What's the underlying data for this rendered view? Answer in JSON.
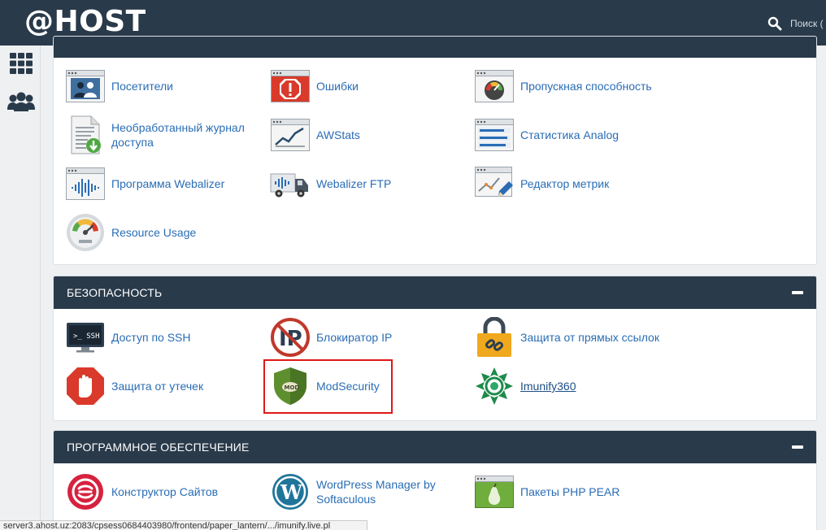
{
  "brand": {
    "logo": "@HOST"
  },
  "search": {
    "placeholder": "Поиск ("
  },
  "sidebar": {
    "items": [
      {
        "icon": "grid-icon"
      },
      {
        "icon": "users-icon"
      }
    ]
  },
  "panels": [
    {
      "header": "",
      "items": [
        {
          "label": "Посетители",
          "icon": "visitors-icon"
        },
        {
          "label": "Ошибки",
          "icon": "errors-icon"
        },
        {
          "label": "Пропускная способность",
          "icon": "bandwidth-icon"
        },
        {
          "label": "Необработанный журнал доступа",
          "icon": "raw-access-icon"
        },
        {
          "label": "AWStats",
          "icon": "awstats-icon"
        },
        {
          "label": "Статистика Analog",
          "icon": "analog-stats-icon"
        },
        {
          "label": "Программа Webalizer",
          "icon": "webalizer-icon"
        },
        {
          "label": "Webalizer FTP",
          "icon": "webalizer-ftp-icon"
        },
        {
          "label": "Редактор метрик",
          "icon": "metrics-editor-icon"
        },
        {
          "label": "Resource Usage",
          "icon": "resource-usage-icon"
        }
      ]
    },
    {
      "header": "БЕЗОПАСНОСТЬ",
      "items": [
        {
          "label": "Доступ по SSH",
          "icon": "ssh-icon"
        },
        {
          "label": "Блокиратор IP",
          "icon": "ip-blocker-icon"
        },
        {
          "label": "Защита от прямых ссылок",
          "icon": "hotlink-lock-icon"
        },
        {
          "label": "Защита от утечек",
          "icon": "leech-hand-icon"
        },
        {
          "label": "ModSecurity",
          "icon": "modsecurity-shield-icon"
        },
        {
          "label": "Imunify360",
          "icon": "imunify-icon"
        }
      ]
    },
    {
      "header": "ПРОГРАММНОЕ ОБЕСПЕЧЕНИЕ",
      "items": [
        {
          "label": "Конструктор Сайтов",
          "icon": "site-builder-icon"
        },
        {
          "label": "WordPress Manager by Softaculous",
          "icon": "wordpress-icon"
        },
        {
          "label": "Пакеты PHP PEAR",
          "icon": "php-pear-icon"
        }
      ]
    }
  ],
  "status": {
    "url": "server3.ahost.uz:2083/cpsess0684403980/frontend/paper_lantern/.../imunify.live.pl"
  },
  "colors": {
    "header": "#293a4a",
    "link": "#2a6db5",
    "highlight": "#e01818"
  }
}
